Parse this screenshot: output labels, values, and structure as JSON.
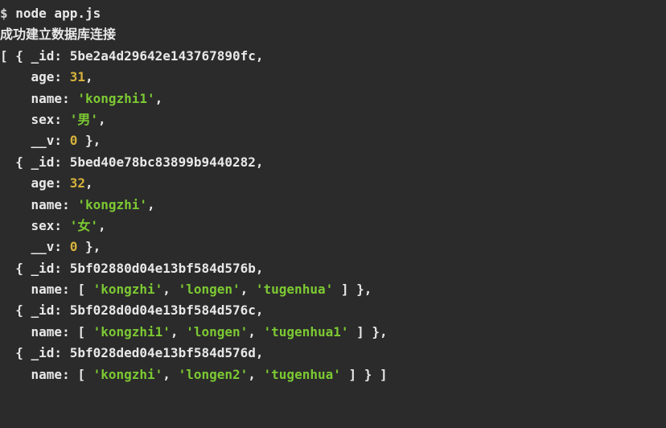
{
  "command": {
    "prompt": "$ ",
    "cmd": "node app.js"
  },
  "connection_msg": "成功建立数据库连接",
  "output": {
    "line1": {
      "prefix": "[ { _id: ",
      "id": "5be2a4d29642e143767890fc",
      "suffix": ","
    },
    "line2": {
      "prefix": "    age: ",
      "value": "31",
      "suffix": ","
    },
    "line3": {
      "prefix": "    name: ",
      "value": "'kongzhi1'",
      "suffix": ","
    },
    "line4": {
      "prefix": "    sex: ",
      "value": "'男'",
      "suffix": ","
    },
    "line5": {
      "prefix": "    __v: ",
      "value": "0",
      "suffix": " },"
    },
    "line6": {
      "prefix": "  { _id: ",
      "id": "5bed40e78bc83899b9440282",
      "suffix": ","
    },
    "line7": {
      "prefix": "    age: ",
      "value": "32",
      "suffix": ","
    },
    "line8": {
      "prefix": "    name: ",
      "value": "'kongzhi'",
      "suffix": ","
    },
    "line9": {
      "prefix": "    sex: ",
      "value": "'女'",
      "suffix": ","
    },
    "line10": {
      "prefix": "    __v: ",
      "value": "0",
      "suffix": " },"
    },
    "line11": {
      "prefix": "  { _id: ",
      "id": "5bf02880d04e13bf584d576b",
      "suffix": ","
    },
    "line12": {
      "prefix": "    name: [ ",
      "v1": "'kongzhi'",
      "sep1": ", ",
      "v2": "'longen'",
      "sep2": ", ",
      "v3": "'tugenhua'",
      "suffix": " ] },"
    },
    "line13": {
      "prefix": "  { _id: ",
      "id": "5bf028d0d04e13bf584d576c",
      "suffix": ","
    },
    "line14": {
      "prefix": "    name: [ ",
      "v1": "'kongzhi1'",
      "sep1": ", ",
      "v2": "'longen'",
      "sep2": ", ",
      "v3": "'tugenhua1'",
      "suffix": " ] },"
    },
    "line15": {
      "prefix": "  { _id: ",
      "id": "5bf028ded04e13bf584d576d",
      "suffix": ","
    },
    "line16": {
      "prefix": "    name: [ ",
      "v1": "'kongzhi'",
      "sep1": ", ",
      "v2": "'longen2'",
      "sep2": ", ",
      "v3": "'tugenhua'",
      "suffix": " ] } ]"
    }
  }
}
